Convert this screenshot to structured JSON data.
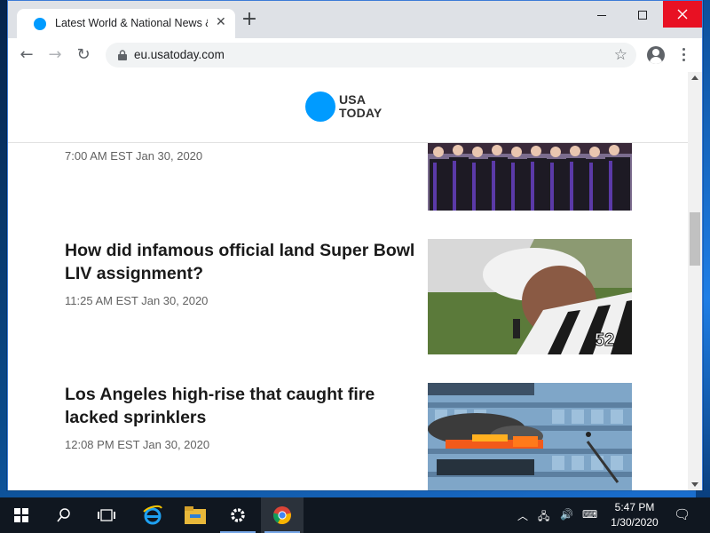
{
  "browser": {
    "tab_title": "Latest World & National News & Headlines",
    "tab_close_glyph": "✕",
    "new_tab_glyph": "+",
    "url": "eu.usatoday.com",
    "back_glyph": "←",
    "forward_glyph": "→",
    "reload_glyph": "↻",
    "bookmark_glyph": "☆",
    "close_glyph": "✕"
  },
  "site": {
    "logo_line1": "USA",
    "logo_line2": "TODAY",
    "brand_color": "#009bff"
  },
  "articles": [
    {
      "headline": "",
      "timestamp": "7:00 AM EST Jan 30, 2020",
      "image_icon": "graduation-photo"
    },
    {
      "headline": "How did infamous official land Super Bowl LIV assignment?",
      "timestamp": "11:25 AM EST Jan 30, 2020",
      "image_icon": "referee-photo"
    },
    {
      "headline": "Los Angeles high-rise that caught fire lacked sprinklers",
      "timestamp": "12:08 PM EST Jan 30, 2020",
      "image_icon": "building-fire-photo"
    }
  ],
  "taskbar": {
    "time": "5:47 PM",
    "date": "1/30/2020",
    "icons": [
      "windows-start-icon",
      "search-icon",
      "task-view-icon",
      "internet-explorer-icon",
      "file-explorer-icon",
      "settings-icon",
      "chrome-icon"
    ]
  }
}
